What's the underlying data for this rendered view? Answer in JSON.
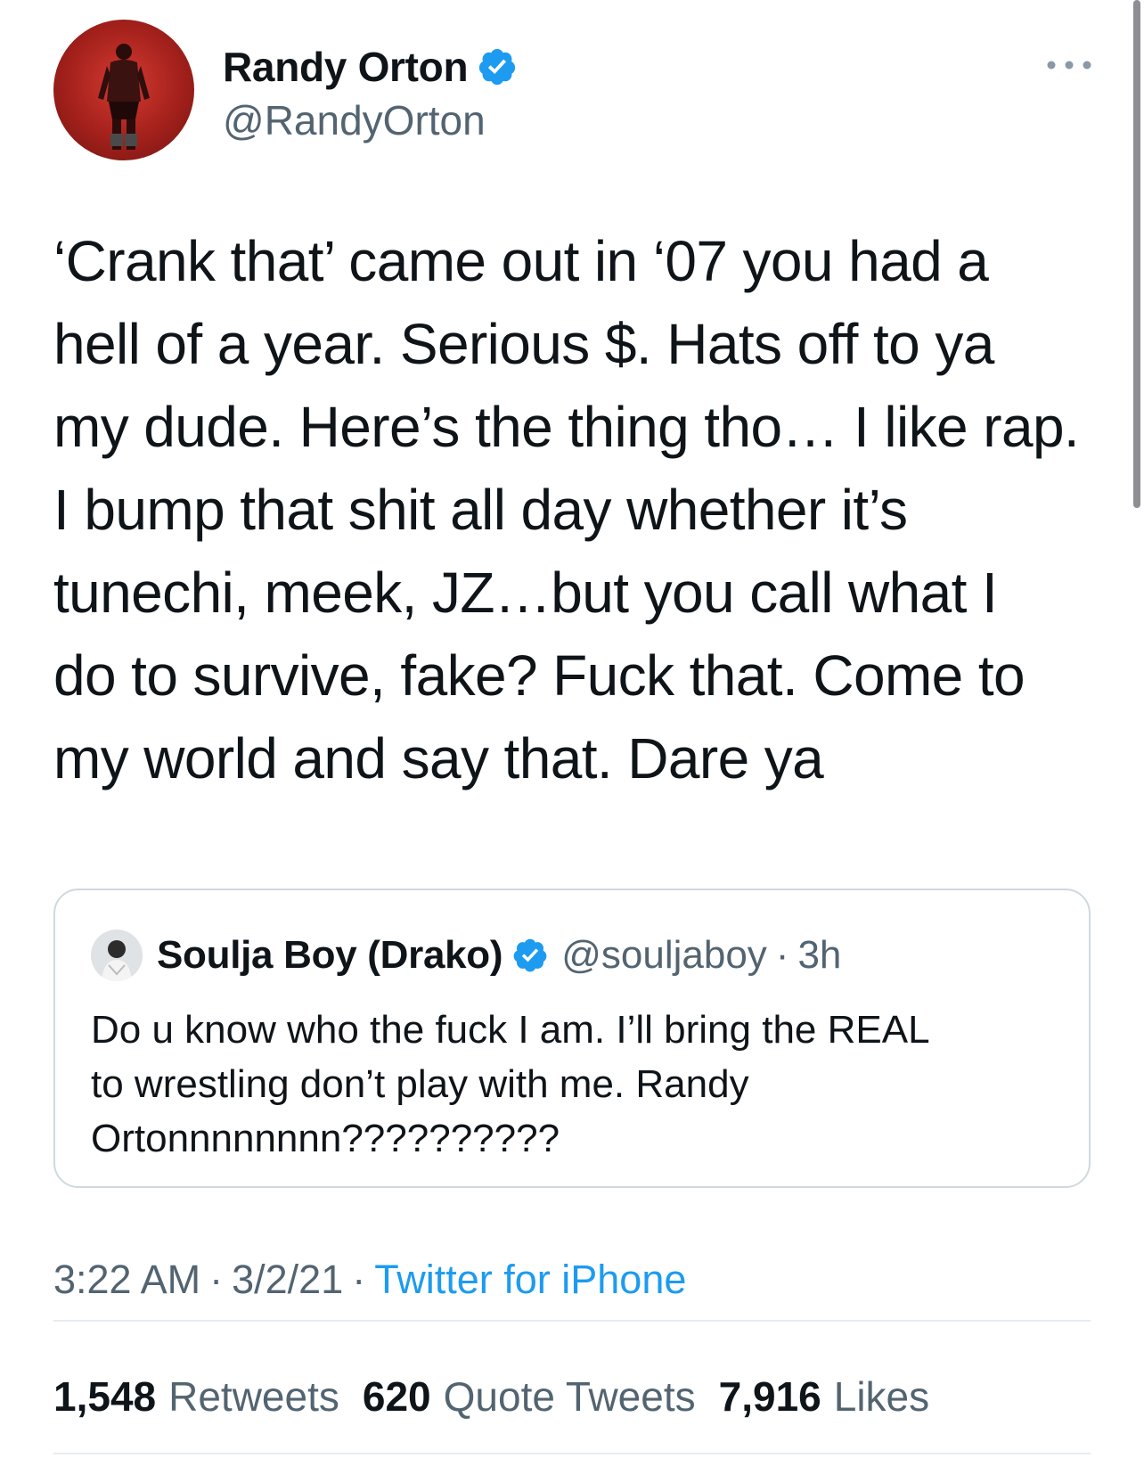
{
  "tweet": {
    "author": {
      "display_name": "Randy Orton",
      "handle": "@RandyOrton",
      "verified": true
    },
    "text_lines": [
      "‘Crank that’ came out in ‘07 you had a",
      "hell of a year. Serious $. Hats off to ya",
      "my dude. Here’s the thing tho… I like rap.",
      "I bump that shit all day whether it’s",
      "tunechi, meek, JZ…but you call what I",
      "do to survive, fake? Fuck that. Come to",
      "my world and say that. Dare ya"
    ],
    "time": "3:22 AM",
    "date": "3/2/21",
    "source": "Twitter for iPhone",
    "separator": "·"
  },
  "quoted_tweet": {
    "display_name": "Soulja Boy (Drako)",
    "handle": "@souljaboy",
    "time_ago": "3h",
    "verified": true,
    "text_lines": [
      "Do u know who the fuck I am. I’ll bring the REAL",
      "to wrestling don’t play with me. Randy",
      "Ortonnnnnnnn??????????"
    ]
  },
  "stats": {
    "retweets": {
      "count": "1,548",
      "label": "Retweets"
    },
    "quote_tweets": {
      "count": "620",
      "label": "Quote Tweets"
    },
    "likes": {
      "count": "7,916",
      "label": "Likes"
    }
  },
  "icons": {
    "verified_badge": "verified-badge-icon",
    "more_options": "more-horizontal-icon"
  },
  "colors": {
    "accent": "#1d9bf0",
    "secondary_text": "#536471",
    "primary_text": "#0f1419",
    "border": "#cfd9de"
  }
}
